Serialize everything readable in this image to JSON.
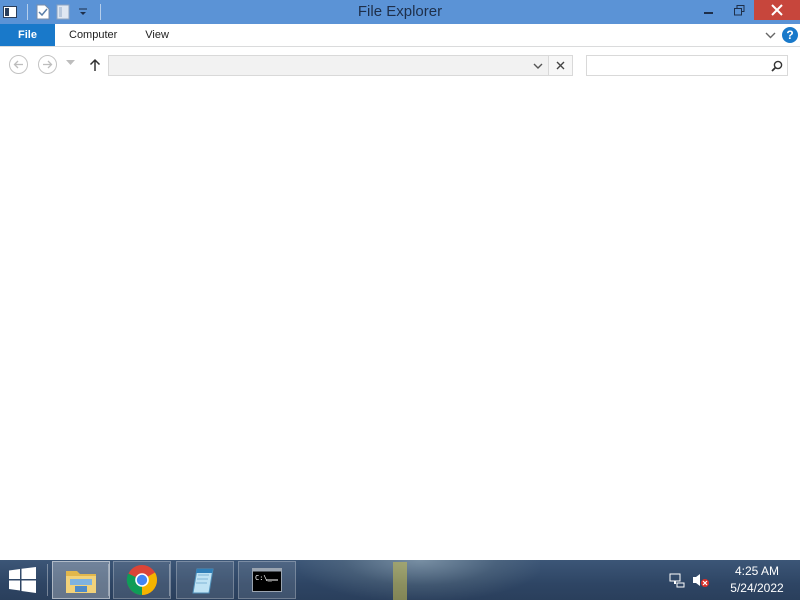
{
  "window": {
    "title": "File Explorer"
  },
  "quick_access": {
    "icons": [
      "properties-icon",
      "new-folder-icon",
      "customize-dropdown-icon"
    ]
  },
  "window_controls": {
    "icons": [
      "minimize-icon",
      "restore-icon",
      "close-icon"
    ]
  },
  "ribbon": {
    "file_label": "File",
    "tabs": [
      {
        "label": "Computer"
      },
      {
        "label": "View"
      }
    ],
    "icons": [
      "expand-ribbon-icon",
      "help-icon"
    ],
    "help_glyph": "?"
  },
  "navigation": {
    "icons": [
      "back-arrow-icon",
      "forward-arrow-icon",
      "recent-locations-icon",
      "up-arrow-icon"
    ],
    "address_value": "",
    "address_placeholder": "",
    "search_value": "",
    "search_placeholder": ""
  },
  "taskbar": {
    "apps": [
      {
        "name": "file-explorer",
        "icon": "folder-icon",
        "active": true
      },
      {
        "name": "chrome",
        "icon": "chrome-icon",
        "active": false
      },
      {
        "name": "notepad",
        "icon": "notepad-icon",
        "active": false
      },
      {
        "name": "command-prompt",
        "icon": "cmd-icon",
        "active": false
      }
    ],
    "tray_icons": [
      "network-icon",
      "volume-muted-icon"
    ],
    "clock": {
      "time": "4:25 AM",
      "date": "5/24/2022"
    }
  },
  "colors": {
    "titlebar": "#5b93d6",
    "file_tab": "#1979ca",
    "close_button": "#c7463c",
    "taskbar": "#2e4564"
  }
}
